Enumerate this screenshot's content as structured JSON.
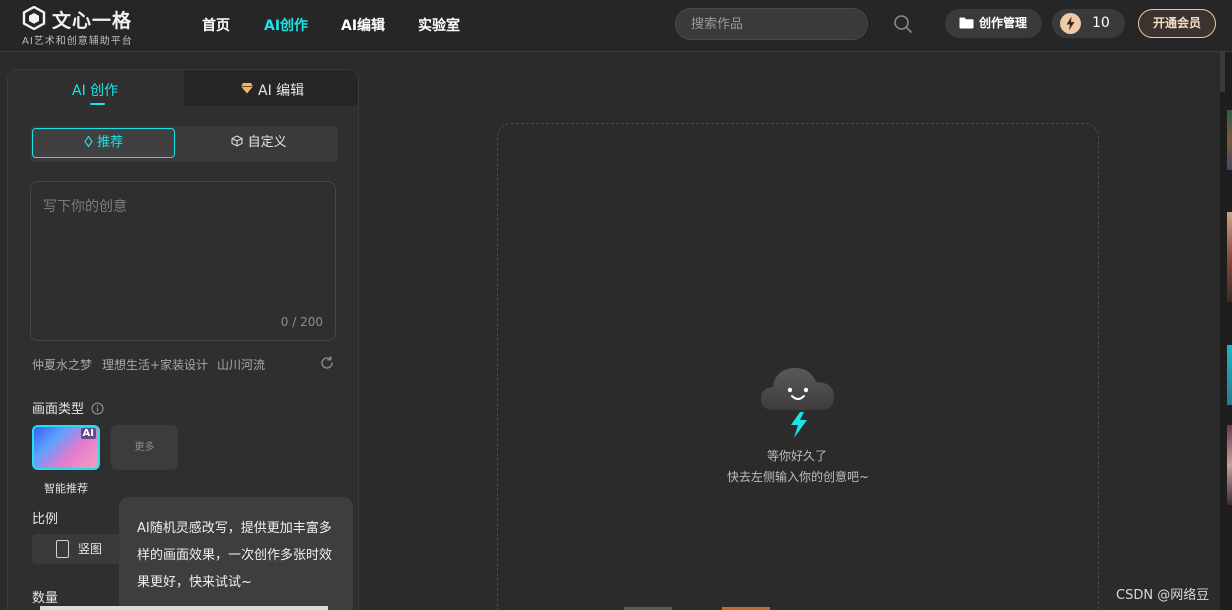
{
  "header": {
    "logo_title": "文心一格",
    "logo_subtitle": "AI艺术和创意辅助平台",
    "nav": [
      {
        "label": "首页",
        "active": false
      },
      {
        "label": "AI创作",
        "active": true
      },
      {
        "label": "AI编辑",
        "active": false
      },
      {
        "label": "实验室",
        "active": false
      }
    ],
    "search_placeholder": "搜索作品",
    "manage_label": "创作管理",
    "credits": "10",
    "vip_label": "开通会员"
  },
  "panel": {
    "tabs": [
      {
        "label": "AI 创作",
        "active": true
      },
      {
        "label": "AI 编辑",
        "active": false
      }
    ],
    "modes": [
      {
        "label": "推荐",
        "active": true
      },
      {
        "label": "自定义",
        "active": false
      }
    ],
    "prompt_placeholder": "写下你的创意",
    "counter": "0 / 200",
    "suggestions": [
      "仲夏水之梦",
      "理想生活+家装设计",
      "山川河流"
    ],
    "scene_type_label": "画面类型",
    "scene_options": [
      {
        "label": "智能推荐",
        "tag": "AI",
        "selected": true
      },
      {
        "label": "更多",
        "selected": false
      }
    ],
    "ratio_label": "比例",
    "ratio_option": "竖图",
    "quantity_label": "数量",
    "tooltip": "AI随机灵感改写，提供更加丰富多样的画面效果，一次创作多张时效果更好，快来试试~"
  },
  "canvas": {
    "empty_title": "等你好久了",
    "empty_hint": "快去左侧输入你的创意吧~"
  },
  "watermark": "CSDN @网络豆",
  "colors": {
    "accent": "#1de3e8",
    "background": "#2b2b2b",
    "panel": "#2f2f2f",
    "vip_gold": "#e8c7a5"
  }
}
